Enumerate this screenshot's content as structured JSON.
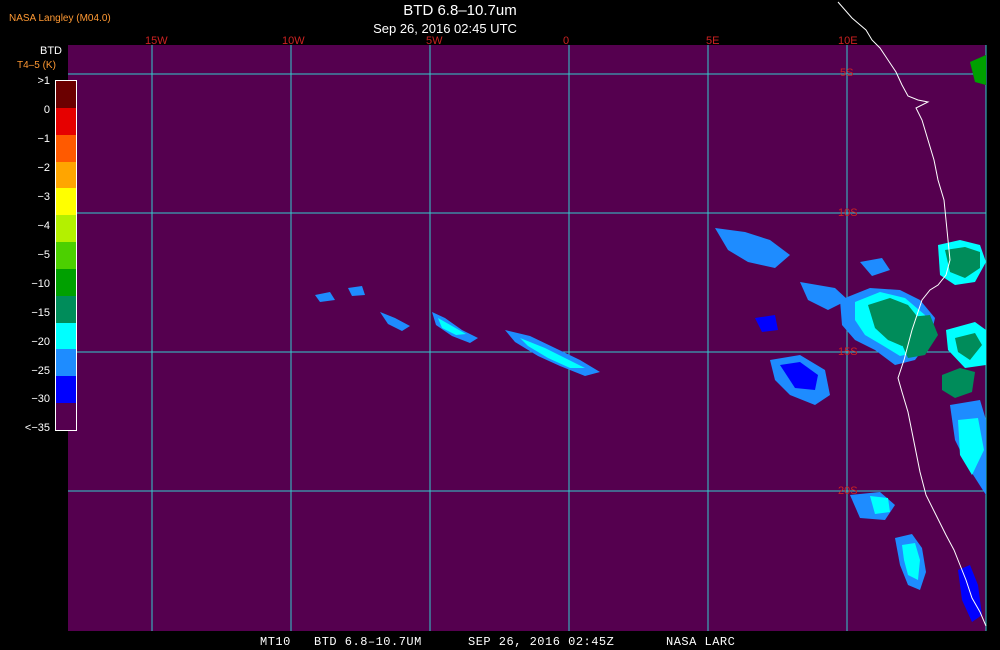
{
  "header": {
    "credit": "NASA Langley (M04.0)",
    "title": "BTD 6.8–10.7um",
    "subtitle": "Sep 26, 2016 02:45 UTC"
  },
  "legend": {
    "title": "BTD",
    "unit": "T4–5 (K)",
    "labels": [
      ">1",
      "0",
      "−1",
      "−2",
      "−3",
      "−4",
      "−5",
      "−10",
      "−15",
      "−20",
      "−25",
      "−30",
      "<−35"
    ],
    "colors": [
      "#6b0000",
      "#e60000",
      "#ff5a00",
      "#ffa500",
      "#ffff00",
      "#b4f000",
      "#4cd000",
      "#00a000",
      "#008c5a",
      "#00ffff",
      "#1e8cff",
      "#0000ff",
      "#55004f"
    ]
  },
  "grid": {
    "longitude_labels": [
      "15W",
      "10W",
      "5W",
      "0",
      "5E",
      "10E"
    ],
    "latitude_labels": [
      "5S",
      "10S",
      "15S",
      "20S"
    ],
    "color": "#33cccc",
    "label_color": "#cc2222"
  },
  "map": {
    "background_color": "#55004f",
    "coastline_color": "#ffffff"
  },
  "footer": {
    "satellite": "MT10",
    "product": "BTD 6.8–10.7UM",
    "datetime": "SEP 26, 2016 02:45Z",
    "agency": "NASA LARC"
  }
}
